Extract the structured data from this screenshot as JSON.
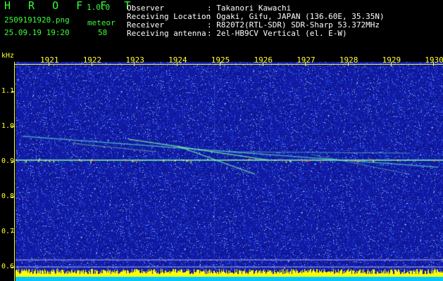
{
  "app": {
    "name": "H R O F F T",
    "version": "1.0.0"
  },
  "file": {
    "name": "2509191920.png",
    "timestamp": "25.09.19 19:20"
  },
  "meteor": {
    "label": "meteor",
    "count": "58"
  },
  "info": {
    "observer_label": "Observer",
    "observer_value": ": Takanori Kawachi",
    "location_label": "Receiving Location",
    "location_value": ": Ogaki, Gifu, JAPAN (136.60E, 35.35N)",
    "receiver_label": "Receiver",
    "receiver_value": ": R820T2(RTL-SDR) SDR-Sharp 53.372MHz",
    "antenna_label": "Receiving antenna",
    "antenna_value": ": 2el-HB9CV Vertical (el. E-W)"
  },
  "axes": {
    "y_unit": "kHz",
    "y_ticks": [
      "1.1",
      "1.0",
      "0.9",
      "0.8",
      "0.7",
      "0.6"
    ],
    "x_ticks": [
      "1921",
      "1922",
      "1923",
      "1924",
      "1925",
      "1926",
      "1927",
      "1928",
      "1929",
      "1930"
    ]
  },
  "colors": {
    "background": "#1a1fa0",
    "accent_green": "#39ff39",
    "label_yellow": "#ffff33",
    "level_bar": "#ffff00",
    "level_bar_low": "#00c8ff"
  }
}
